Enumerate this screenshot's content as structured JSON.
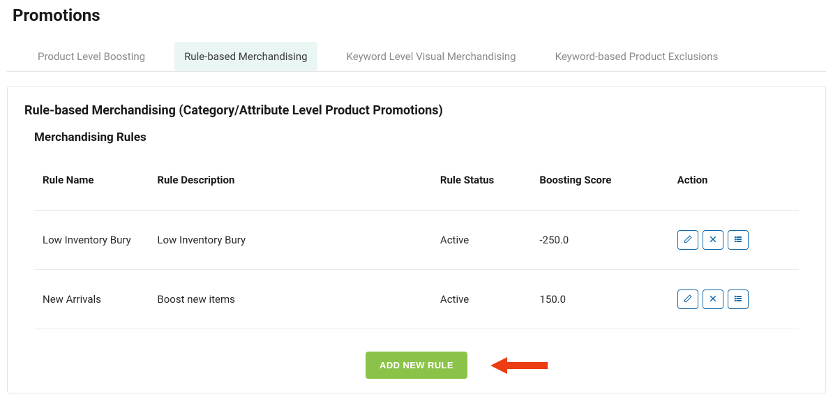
{
  "page": {
    "title": "Promotions"
  },
  "tabs": [
    {
      "label": "Product Level Boosting"
    },
    {
      "label": "Rule-based Merchandising"
    },
    {
      "label": "Keyword Level Visual Merchandising"
    },
    {
      "label": "Keyword-based Product Exclusions"
    }
  ],
  "panel": {
    "title": "Rule-based Merchandising (Category/Attribute Level Product Promotions)",
    "section_title": "Merchandising Rules"
  },
  "table": {
    "headers": {
      "name": "Rule Name",
      "description": "Rule Description",
      "status": "Rule Status",
      "score": "Boosting Score",
      "action": "Action"
    },
    "rows": [
      {
        "name": "Low Inventory Bury",
        "description": "Low Inventory Bury",
        "status": "Active",
        "score": "-250.0"
      },
      {
        "name": "New Arrivals",
        "description": "Boost new items",
        "status": "Active",
        "score": "150.0"
      }
    ]
  },
  "buttons": {
    "add_rule": "ADD NEW RULE"
  }
}
